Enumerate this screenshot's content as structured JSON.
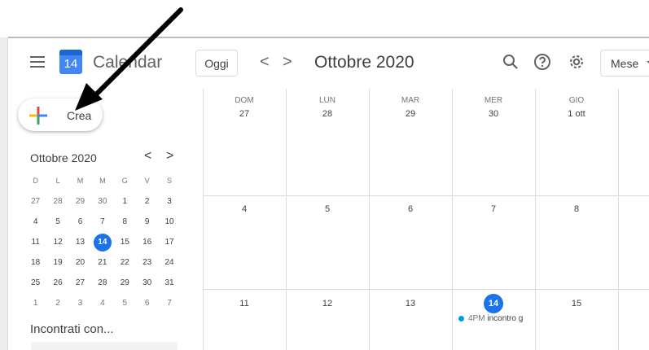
{
  "header": {
    "app_title": "Calendar",
    "logo_day": "14",
    "today_label": "Oggi",
    "prev_label": "<",
    "next_label": ">",
    "month_title": "Ottobre 2020",
    "view_label": "Mese"
  },
  "sidebar": {
    "create_label": "Crea",
    "mini_title": "Ottobre 2020",
    "mini_prev": "<",
    "mini_next": ">",
    "weekday_heads": [
      "D",
      "L",
      "M",
      "M",
      "G",
      "V",
      "S"
    ],
    "weeks": [
      [
        "27",
        "28",
        "29",
        "30",
        "1",
        "2",
        "3"
      ],
      [
        "4",
        "5",
        "6",
        "7",
        "8",
        "9",
        "10"
      ],
      [
        "11",
        "12",
        "13",
        "14",
        "15",
        "16",
        "17"
      ],
      [
        "18",
        "19",
        "20",
        "21",
        "22",
        "23",
        "24"
      ],
      [
        "25",
        "26",
        "27",
        "28",
        "29",
        "30",
        "31"
      ],
      [
        "1",
        "2",
        "3",
        "4",
        "5",
        "6",
        "7"
      ]
    ],
    "meet_title": "Incontrati con..."
  },
  "grid": {
    "days_of_week": [
      "DOM",
      "LUN",
      "MAR",
      "MER",
      "GIO"
    ],
    "week1": [
      "27",
      "28",
      "29",
      "30",
      "1 ott"
    ],
    "week2": [
      "4",
      "5",
      "6",
      "7",
      "8"
    ],
    "week3": [
      "11",
      "12",
      "13",
      "14",
      "15"
    ],
    "event": {
      "time": "4PM",
      "title": "incontro g"
    }
  },
  "colors": {
    "accent": "#1a73e8",
    "event_dot": "#039be5",
    "plus_blue": "#4285f4",
    "plus_red": "#ea4335",
    "plus_yellow": "#fbbc04",
    "plus_green": "#34a853"
  }
}
